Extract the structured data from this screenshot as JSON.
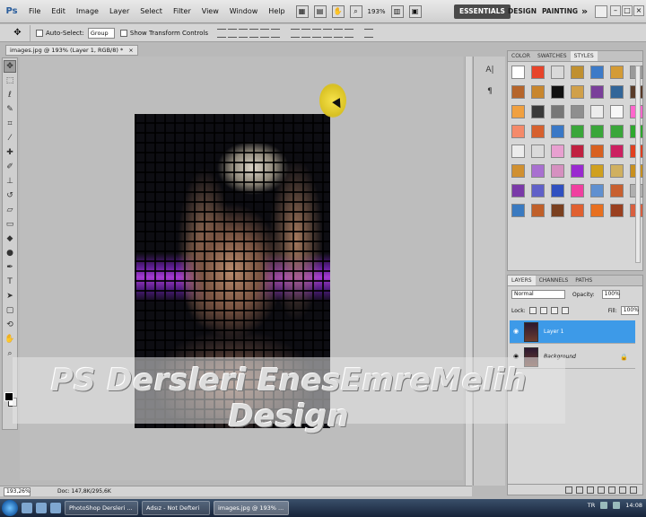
{
  "app": {
    "logo": "Ps"
  },
  "menu": [
    "File",
    "Edit",
    "Image",
    "Layer",
    "Select",
    "Filter",
    "View",
    "Window",
    "Help"
  ],
  "menubar_tools": {
    "zoom": "193%"
  },
  "workspaces": {
    "essentials": "ESSENTIALS",
    "design": "DESIGN",
    "painting": "PAINTING",
    "more": "»"
  },
  "window_controls": {
    "minimize": "–",
    "restore": "□",
    "close": "×"
  },
  "options_bar": {
    "auto_select_label": "Auto-Select:",
    "auto_select_value": "Group",
    "transform_label": "Show Transform Controls"
  },
  "document": {
    "tab_title": "images.jpg @ 193% (Layer 1, RGB/8) *",
    "tab_close": "×"
  },
  "status": {
    "zoom": "193,26%",
    "doc_size": "Doc: 147,8K/295,6K"
  },
  "styles_panel": {
    "tabs": [
      "COLOR",
      "SWATCHES",
      "STYLES"
    ],
    "swatches": [
      "#ffffff",
      "#e7442a",
      "#d9d9d9",
      "#c09030",
      "#3c7ac8",
      "#d49b35",
      "#9a9a9a",
      "#b5652b",
      "#c8862e",
      "#111111",
      "#d0a04a",
      "#7a3f9a",
      "#336699",
      "#5a3c2a",
      "#f0a040",
      "#3a3a3a",
      "#777777",
      "#8f8f8f",
      "#ececec",
      "#f7f7f7",
      "#ff66cc",
      "#f48a6a",
      "#d6602e",
      "#3a78c6",
      "#3aa63a",
      "#3aa63a",
      "#3aa63a",
      "#2ea82e",
      "#ececec",
      "#dadada",
      "#e8a0d0",
      "#c02040",
      "#d86020",
      "#cc2060",
      "#e04020",
      "#d09030",
      "#a870d0",
      "#d690c0",
      "#9a2ad0",
      "#d0a020",
      "#d0b060",
      "#c89020",
      "#7a3aa8",
      "#6060c8",
      "#3050c0",
      "#f040a0",
      "#6090d0",
      "#c86030",
      "#b0b0b0",
      "#3a7ac0",
      "#c0602a",
      "#7a4020",
      "#e06030",
      "#e87020",
      "#9a4020",
      "#d86040"
    ]
  },
  "layers_panel": {
    "tabs": [
      "LAYERS",
      "CHANNELS",
      "PATHS"
    ],
    "blend_mode": "Normal",
    "opacity_label": "Opacity:",
    "opacity_value": "100%",
    "lock_label": "Lock:",
    "fill_label": "Fill:",
    "fill_value": "100%",
    "layers": [
      {
        "name": "Layer 1",
        "selected": true
      },
      {
        "name": "Background",
        "selected": false
      }
    ]
  },
  "watermark": "PS Dersleri EnesEmreMelih Design",
  "taskbar": {
    "tasks": [
      "PhotoShop Dersleri ...",
      "Adsız - Not Defteri",
      "images.jpg @ 193% ..."
    ],
    "lang": "TR",
    "time": "14:08"
  }
}
